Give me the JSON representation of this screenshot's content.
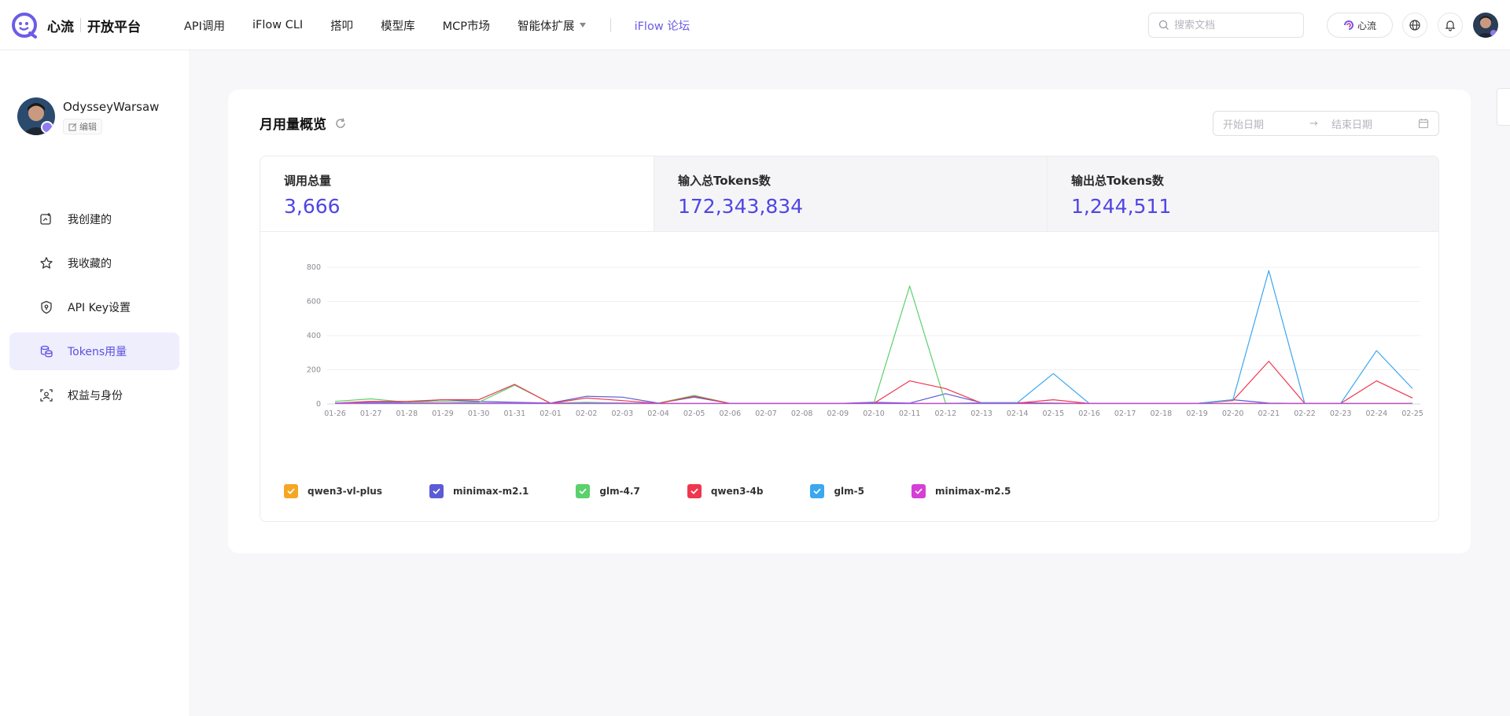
{
  "brand": {
    "name": "心流",
    "product": "开放平台"
  },
  "nav": {
    "items": [
      "API调用",
      "iFlow CLI",
      "搭叩",
      "模型库",
      "MCP市场",
      "智能体扩展"
    ],
    "forum": "iFlow 论坛"
  },
  "search": {
    "placeholder": "搜索文档"
  },
  "header": {
    "xinliu_label": "心流"
  },
  "user": {
    "name": "OdysseyWarsaw",
    "edit_label": "编辑"
  },
  "sidebar": {
    "items": [
      {
        "label": "我创建的",
        "icon": "created-icon"
      },
      {
        "label": "我收藏的",
        "icon": "star-icon"
      },
      {
        "label": "API Key设置",
        "icon": "shield-key-icon"
      },
      {
        "label": "Tokens用量",
        "icon": "coins-icon",
        "active": true
      },
      {
        "label": "权益与身份",
        "icon": "identity-icon"
      }
    ]
  },
  "card": {
    "title": "月用量概览",
    "date_start_placeholder": "开始日期",
    "date_arrow": "→",
    "date_end_placeholder": "结束日期"
  },
  "stats": [
    {
      "label": "调用总量",
      "value": "3,666"
    },
    {
      "label": "输入总Tokens数",
      "value": "172,343,834"
    },
    {
      "label": "输出总Tokens数",
      "value": "1,244,511"
    }
  ],
  "chart_data": {
    "type": "line",
    "x": [
      "01-26",
      "01-27",
      "01-28",
      "01-29",
      "01-30",
      "01-31",
      "02-01",
      "02-02",
      "02-03",
      "02-04",
      "02-05",
      "02-06",
      "02-07",
      "02-08",
      "02-09",
      "02-10",
      "02-11",
      "02-12",
      "02-13",
      "02-14",
      "02-15",
      "02-16",
      "02-17",
      "02-18",
      "02-19",
      "02-20",
      "02-21",
      "02-22",
      "02-23",
      "02-24",
      "02-25"
    ],
    "ylim": [
      0,
      800
    ],
    "yticks": [
      0,
      200,
      400,
      600,
      800
    ],
    "grid": true,
    "legend": "bottom-left",
    "series": [
      {
        "name": "qwen3-vl-plus",
        "color": "#f5a623",
        "values": [
          5,
          8,
          5,
          5,
          5,
          5,
          3,
          5,
          5,
          3,
          3,
          3,
          3,
          3,
          3,
          3,
          3,
          3,
          3,
          3,
          3,
          3,
          3,
          3,
          3,
          3,
          3,
          3,
          3,
          3,
          3
        ]
      },
      {
        "name": "minimax-m2.1",
        "color": "#5b5bd6",
        "values": [
          5,
          10,
          10,
          25,
          15,
          10,
          5,
          45,
          40,
          5,
          40,
          3,
          3,
          3,
          3,
          10,
          5,
          60,
          8,
          8,
          5,
          3,
          3,
          3,
          3,
          25,
          5,
          3,
          3,
          3,
          3
        ]
      },
      {
        "name": "glm-4.7",
        "color": "#5ad16b",
        "values": [
          15,
          30,
          10,
          15,
          10,
          110,
          5,
          10,
          5,
          5,
          50,
          3,
          3,
          3,
          3,
          3,
          690,
          5,
          3,
          3,
          3,
          3,
          3,
          3,
          3,
          3,
          3,
          3,
          3,
          3,
          3
        ]
      },
      {
        "name": "qwen3-4b",
        "color": "#f0364f",
        "values": [
          5,
          15,
          15,
          25,
          25,
          115,
          3,
          35,
          20,
          3,
          45,
          3,
          3,
          3,
          3,
          3,
          135,
          90,
          5,
          5,
          25,
          3,
          3,
          3,
          3,
          20,
          250,
          3,
          3,
          135,
          35
        ]
      },
      {
        "name": "glm-5",
        "color": "#3aa7f0",
        "values": [
          5,
          5,
          5,
          5,
          5,
          5,
          3,
          5,
          5,
          3,
          3,
          3,
          3,
          3,
          3,
          3,
          3,
          3,
          8,
          8,
          178,
          3,
          3,
          3,
          3,
          25,
          780,
          3,
          3,
          312,
          90
        ]
      },
      {
        "name": "minimax-m2.5",
        "color": "#d63fd6",
        "values": [
          3,
          3,
          3,
          3,
          3,
          3,
          3,
          3,
          3,
          3,
          3,
          3,
          3,
          3,
          3,
          3,
          3,
          3,
          3,
          3,
          3,
          3,
          3,
          3,
          3,
          3,
          3,
          3,
          3,
          3,
          3
        ]
      }
    ]
  }
}
